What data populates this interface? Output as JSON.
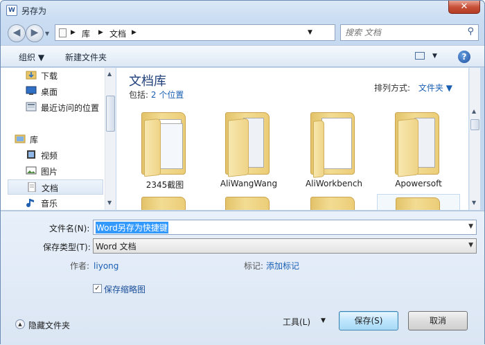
{
  "window": {
    "title": "另存为",
    "close_glyph": "✕"
  },
  "nav": {
    "back_glyph": "◀",
    "forward_glyph": "▶",
    "breadcrumb": [
      "库",
      "文档"
    ],
    "search_placeholder": "搜索 文档"
  },
  "toolbar": {
    "organize": "组织 ▼",
    "new_folder": "新建文件夹",
    "help_glyph": "?"
  },
  "sidebar": {
    "items": [
      {
        "label": "下载",
        "icon": "download-folder-icon"
      },
      {
        "label": "桌面",
        "icon": "desktop-icon"
      },
      {
        "label": "最近访问的位置",
        "icon": "recent-places-icon"
      },
      {
        "label": "库",
        "icon": "library-icon"
      },
      {
        "label": "视频",
        "icon": "video-icon"
      },
      {
        "label": "图片",
        "icon": "pictures-icon"
      },
      {
        "label": "文档",
        "icon": "documents-icon",
        "selected": true
      },
      {
        "label": "音乐",
        "icon": "music-icon"
      }
    ]
  },
  "library": {
    "title": "文档库",
    "includes_label": "包括:",
    "includes_link": "2 个位置",
    "arrange_label": "排列方式:",
    "arrange_value": "文件夹 ▼"
  },
  "folders": [
    {
      "name": "2345截图",
      "style": "screens"
    },
    {
      "name": "AliWangWang",
      "style": "files"
    },
    {
      "name": "AliWorkbench",
      "style": "paper"
    },
    {
      "name": "Apowersoft",
      "style": "files"
    }
  ],
  "form": {
    "filename_label": "文件名(N):",
    "filename_value": "Word另存为快捷键",
    "savetype_label": "保存类型(T):",
    "savetype_value": "Word 文档",
    "author_label": "作者:",
    "author_value": "liyong",
    "tags_label": "标记:",
    "tags_value": "添加标记",
    "thumbnail_label": "保存缩略图",
    "thumbnail_checked": true
  },
  "footer": {
    "hide_folders": "隐藏文件夹",
    "tools": "工具(L)",
    "save": "保存(S)",
    "cancel": "取消"
  }
}
